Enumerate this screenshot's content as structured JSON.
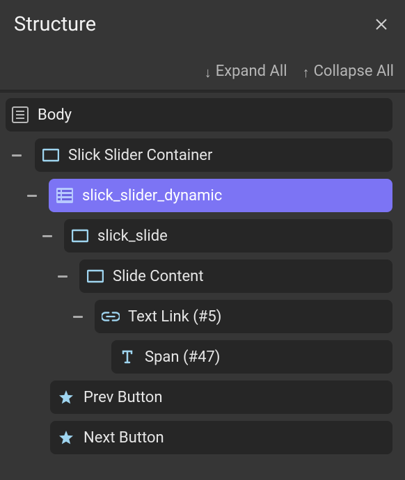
{
  "panel": {
    "title": "Structure",
    "expand_label": "Expand All",
    "collapse_label": "Collapse All"
  },
  "tree": {
    "body": "Body",
    "slider_container": "Slick Slider Container",
    "slider_dynamic": "slick_slider_dynamic",
    "slick_slide": "slick_slide",
    "slide_content": "Slide Content",
    "text_link": "Text Link (#5)",
    "span": "Span (#47)",
    "prev_button": "Prev Button",
    "next_button": "Next Button"
  },
  "icons": {
    "body": "body-icon",
    "container": "container-icon",
    "list": "list-icon",
    "link": "link-icon",
    "text": "text-icon",
    "star": "star-icon"
  }
}
